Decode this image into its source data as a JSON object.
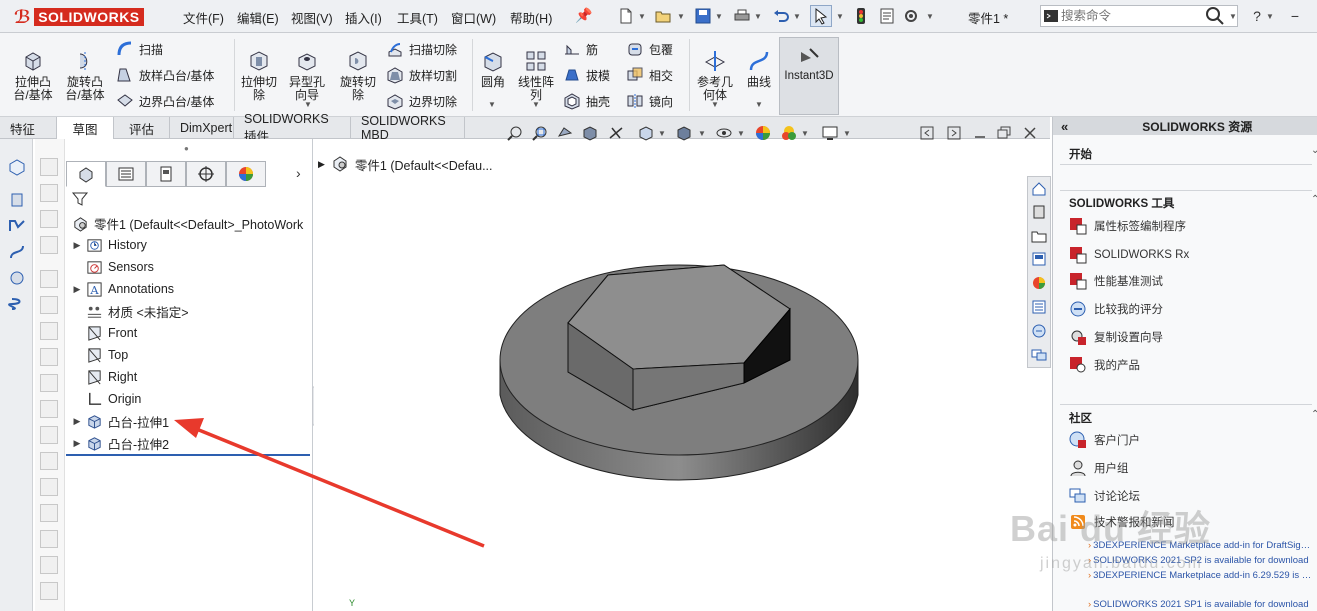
{
  "app": {
    "brand": "SOLIDWORKS",
    "document_title": "零件1 *",
    "search_placeholder": "搜索命令"
  },
  "menu": [
    "文件(F)",
    "编辑(E)",
    "视图(V)",
    "插入(I)",
    "工具(T)",
    "窗口(W)",
    "帮助(H)"
  ],
  "window_controls": [
    "?",
    "−",
    "□",
    "×"
  ],
  "ribbon": {
    "extrude_boss": "拉伸凸\n台/基体",
    "revolve_boss": "旋转凸\n台/基体",
    "sweep": "扫描",
    "loft_boss": "放样凸台/基体",
    "boundary_boss": "边界凸台/基体",
    "extrude_cut": "拉伸切\n除",
    "hole_wizard": "异型孔\n向导",
    "revolve_cut": "旋转切\n除",
    "swept_cut": "扫描切除",
    "lofted_cut": "放样切割",
    "boundary_cut": "边界切除",
    "fillet": "圆角",
    "linear_pattern": "线性阵\n列",
    "rib": "筋",
    "draft": "拔模",
    "shell": "抽壳",
    "wrap": "包覆",
    "intersect": "相交",
    "mirror": "镜向",
    "ref_geometry": "参考几\n何体",
    "curves": "曲线",
    "instant3d": "Instant3D"
  },
  "tabs": [
    "特征",
    "草图",
    "评估",
    "DimXpert",
    "SOLIDWORKS 插件",
    "SOLIDWORKS MBD"
  ],
  "tree": {
    "root": "零件1  (Default<<Default>_PhotoWork",
    "items": [
      {
        "label": "History",
        "expand": true,
        "icon": "history-icon"
      },
      {
        "label": "Sensors",
        "expand": false,
        "icon": "sensors-icon"
      },
      {
        "label": "Annotations",
        "expand": true,
        "icon": "annotations-icon"
      },
      {
        "label": "材质 <未指定>",
        "expand": false,
        "icon": "material-icon"
      },
      {
        "label": "Front",
        "expand": false,
        "icon": "plane-icon"
      },
      {
        "label": "Top",
        "expand": false,
        "icon": "plane-icon"
      },
      {
        "label": "Right",
        "expand": false,
        "icon": "plane-icon"
      },
      {
        "label": "Origin",
        "expand": false,
        "icon": "origin-icon"
      },
      {
        "label": "凸台-拉伸1",
        "expand": true,
        "icon": "extrude-feature-icon"
      },
      {
        "label": "凸台-拉伸2",
        "expand": true,
        "icon": "extrude-feature-icon"
      }
    ]
  },
  "viewport": {
    "breadcrumb": "零件1   (Default<<Defau...",
    "axis_label": "Y"
  },
  "taskpane": {
    "title": "SOLIDWORKS 资源",
    "section_start": "开始",
    "section_tools": "SOLIDWORKS 工具",
    "tools": [
      "属性标签编制程序",
      "SOLIDWORKS Rx",
      "性能基准测试",
      "比较我的评分",
      "复制设置向导",
      "我的产品"
    ],
    "section_community": "社区",
    "community": [
      "客户门户",
      "用户组",
      "讨论论坛",
      "技术警报和新闻"
    ],
    "news": [
      "3DEXPERIENCE Marketplace add-in for DraftSigh...",
      "SOLIDWORKS 2021 SP2 is available for download",
      "3DEXPERIENCE Marketplace add-in 6.29.529 is a...",
      "SOLIDWORKS 2021 SP1 is available for download"
    ]
  },
  "watermark": {
    "main": "Bai du 经验",
    "sub": "jingyan.baidu.com"
  },
  "colors": {
    "brand_red": "#d52b1e",
    "arrow_red": "#e8392c",
    "accent_blue": "#2d6fd8"
  }
}
